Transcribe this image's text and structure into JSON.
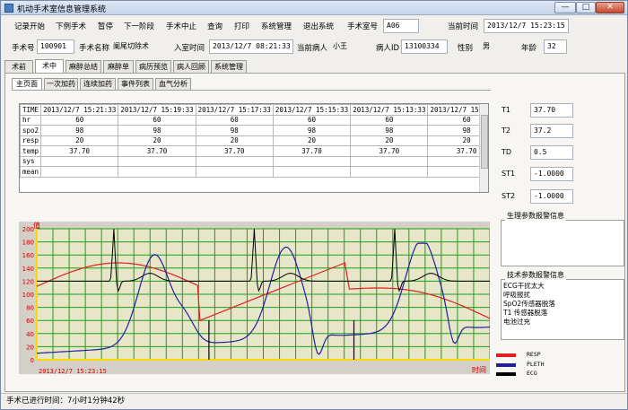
{
  "window": {
    "title": "机动手术室信息管理系统",
    "minimize": "—",
    "maximize": "□",
    "close": "✕"
  },
  "menu": [
    "记录开始",
    "下例手术",
    "暂停",
    "下一阶段",
    "手术中止",
    "查询",
    "打印",
    "系统管理",
    "退出系统"
  ],
  "room": {
    "label": "手术室号",
    "value": "A06"
  },
  "current_time": {
    "label": "当前时间",
    "value": "2013/12/7 15:23:15"
  },
  "info": {
    "surgery_no_label": "手术号",
    "surgery_no": "100901",
    "surgery_name_label": "手术名称",
    "surgery_name": "阑尾切除术",
    "admit_time_label": "入室时间",
    "admit_time": "2013/12/7 08:21:33",
    "patient_label": "当前病人",
    "patient": "小王",
    "patient_id_label": "病人ID",
    "patient_id": "13100334",
    "gender_label": "性别",
    "gender": "男",
    "age_label": "年龄",
    "age": "32"
  },
  "tabs": [
    "术前",
    "术中",
    "麻醉总结",
    "麻醉单",
    "病历预览",
    "病人回顾",
    "系统管理"
  ],
  "subtabs": [
    "主页面",
    "一次加药",
    "连续加药",
    "事件列表",
    "血气分析"
  ],
  "table": {
    "corner": "TIME",
    "times": [
      "2013/12/7 15:21:33",
      "2013/12/7 15:19:33",
      "2013/12/7 15:17:33",
      "2013/12/7 15:15:33",
      "2013/12/7 15:13:33",
      "2013/12/7 15:11:33",
      "2013/12/7"
    ],
    "rows": [
      {
        "name": "hr",
        "values": [
          "60",
          "60",
          "60",
          "60",
          "60",
          "60",
          ""
        ]
      },
      {
        "name": "spo2",
        "values": [
          "98",
          "98",
          "98",
          "98",
          "98",
          "98",
          ""
        ]
      },
      {
        "name": "resp",
        "values": [
          "20",
          "20",
          "20",
          "20",
          "20",
          "20",
          ""
        ]
      },
      {
        "name": "temp",
        "values": [
          "37.70",
          "37.70",
          "37.70",
          "37.70",
          "37.70",
          "37.70",
          ""
        ]
      },
      {
        "name": "sys",
        "values": [
          "",
          "",
          "",
          "",
          "",
          "",
          ""
        ]
      },
      {
        "name": "mean",
        "values": [
          "",
          "",
          "",
          "",
          "",
          "",
          ""
        ]
      }
    ]
  },
  "params": [
    {
      "label": "T1",
      "value": "37.70"
    },
    {
      "label": "T2",
      "value": "37.2"
    },
    {
      "label": "TD",
      "value": "0.5"
    },
    {
      "label": "ST1",
      "value": "-1.0000"
    },
    {
      "label": "ST2",
      "value": "-1.0000"
    }
  ],
  "physio_alarm_title": "生理参数报警信息",
  "tech_alarm_title": "技术参数报警信息",
  "tech_alarms": [
    "ECG干扰太大",
    "呼吸报扰",
    "SpO2传感器脱落",
    "T1 传感器脱落",
    "电池过充"
  ],
  "chart": {
    "y_ticks": [
      "200",
      "180",
      "160",
      "140",
      "120",
      "100",
      "80",
      "60",
      "40",
      "20",
      "0"
    ],
    "y_axis_label": "值",
    "x_axis_label": "时间",
    "start_time": "2013/12/7 15:23:15"
  },
  "legend": [
    {
      "name": "RESP",
      "color": "#e02020"
    },
    {
      "name": "PLETH",
      "color": "#2020a0"
    },
    {
      "name": "ECG",
      "color": "#000000"
    }
  ],
  "status": "手术已进行时间：7小时1分钟42秒"
}
